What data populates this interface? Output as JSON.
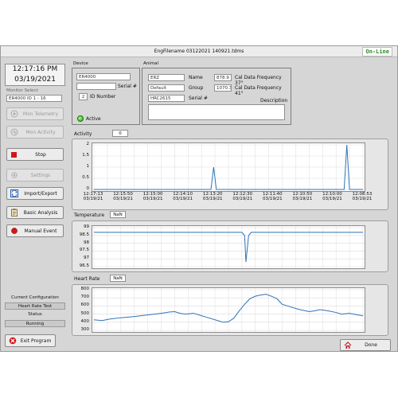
{
  "window": {
    "title": "EngFilename 03122021 140921.tdms",
    "status": "On-Line"
  },
  "clock": {
    "time": "12:17:16 PM",
    "date": "03/19/2021"
  },
  "monitor": {
    "label": "Monitor Select",
    "value": "ER4000 ID 1 - 16"
  },
  "buttons": {
    "mon_telemetry": "Mon Telemetry",
    "mon_activity": "Mon Activity",
    "stop": "Stop",
    "settings": "Settings",
    "import_export": "Import/Export",
    "basic_analysis": "Basic Analysis",
    "manual_event": "Manual Event",
    "exit": "Exit Program",
    "done": "Done"
  },
  "config": {
    "label": "Current Configuration",
    "test": "Heart Rate Test",
    "status_label": "Status",
    "status_value": "Running"
  },
  "device": {
    "title": "Device",
    "type": "ER4000",
    "serial_label": "Serial #",
    "serial": "",
    "id": "2",
    "id_label": "ID Number",
    "active_label": "Active"
  },
  "animal": {
    "title": "Animal",
    "code": "ERZ",
    "name_label": "Name",
    "name": "878.9",
    "freq37_label": "Cal Data Frequency 37°",
    "group_value": "Default",
    "group_label": "Group",
    "group": "1070.3",
    "freq41_label": "Cal Data Frequency 41°",
    "serial": "HRC2615",
    "serial_label": "Serial #",
    "desc_label": "Description",
    "description": ""
  },
  "activity": {
    "label": "Activity",
    "value": "0"
  },
  "temperature": {
    "label": "Temperature",
    "value": "NaN"
  },
  "heart_rate": {
    "label": "Heart Rate",
    "value": "NaN"
  },
  "chart_data": [
    {
      "type": "line",
      "title": "Activity",
      "ylim": [
        0,
        2
      ],
      "yticks": [
        "2",
        "1.5",
        "1",
        "0.5",
        "0"
      ],
      "xticks": [
        {
          "time": "12:17:13",
          "date": "03/19/21"
        },
        {
          "time": "12:15:50",
          "date": "03/19/21"
        },
        {
          "time": "12:15:00",
          "date": "03/19/21"
        },
        {
          "time": "12:14:10",
          "date": "03/19/21"
        },
        {
          "time": "12:13:20",
          "date": "03/19/21"
        },
        {
          "time": "12:12:30",
          "date": "03/19/21"
        },
        {
          "time": "12:11:40",
          "date": "03/19/21"
        },
        {
          "time": "12:10:50",
          "date": "03/19/21"
        },
        {
          "time": "12:10:00",
          "date": "03/19/21"
        },
        {
          "time": "12:08:53",
          "date": "03/19/21"
        }
      ],
      "x": [
        0,
        0.435,
        0.445,
        0.455,
        0.93,
        0.94,
        0.95,
        1
      ],
      "y": [
        0,
        0,
        1,
        0,
        0,
        2,
        0,
        0
      ]
    },
    {
      "type": "line",
      "title": "Temperature",
      "ylim": [
        96.5,
        99
      ],
      "yticks": [
        "99",
        "98.5",
        "98",
        "97.5",
        "97",
        "96.5"
      ],
      "x": [
        0,
        0.55,
        0.56,
        0.565,
        0.575,
        0.585,
        1
      ],
      "y": [
        98.7,
        98.7,
        98.5,
        96.8,
        98.5,
        98.7,
        98.7
      ]
    },
    {
      "type": "line",
      "title": "Heart Rate",
      "ylim": [
        300,
        800
      ],
      "yticks": [
        "800",
        "700",
        "600",
        "500",
        "400",
        "300"
      ],
      "x": [
        0,
        0.03,
        0.06,
        0.1,
        0.15,
        0.2,
        0.25,
        0.28,
        0.3,
        0.32,
        0.34,
        0.37,
        0.4,
        0.43,
        0.46,
        0.48,
        0.5,
        0.52,
        0.54,
        0.56,
        0.58,
        0.6,
        0.62,
        0.64,
        0.66,
        0.68,
        0.7,
        0.73,
        0.76,
        0.78,
        0.8,
        0.82,
        0.84,
        0.87,
        0.9,
        0.92,
        0.95,
        0.98,
        1
      ],
      "y": [
        430,
        420,
        440,
        455,
        470,
        490,
        510,
        525,
        530,
        510,
        500,
        510,
        480,
        450,
        420,
        400,
        405,
        450,
        540,
        620,
        690,
        720,
        735,
        745,
        720,
        690,
        620,
        590,
        560,
        545,
        530,
        540,
        555,
        540,
        520,
        500,
        510,
        490,
        480
      ]
    }
  ]
}
